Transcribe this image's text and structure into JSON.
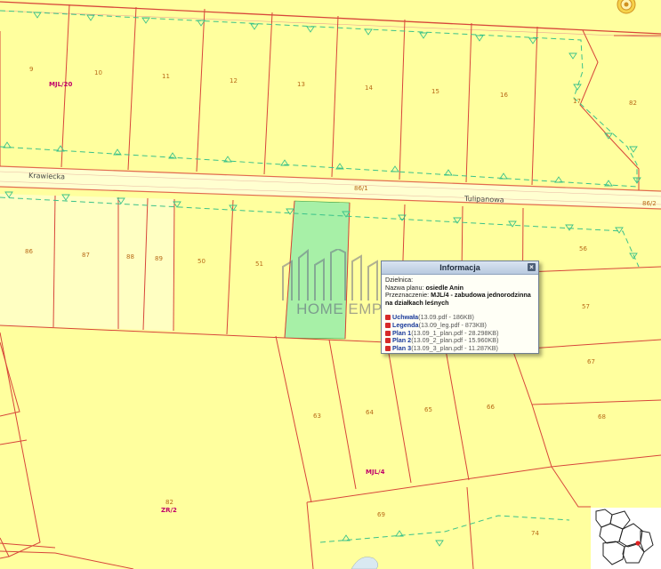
{
  "map": {
    "parcels": [
      "9",
      "10",
      "11",
      "12",
      "13",
      "14",
      "15",
      "16",
      "17",
      "82",
      "86",
      "87",
      "88",
      "89",
      "50",
      "51",
      "56",
      "57",
      "67",
      "68",
      "63",
      "64",
      "65",
      "66",
      "69",
      "74",
      "82"
    ],
    "zones": [
      "MJL/20",
      "MJL/4",
      "ZR/2"
    ],
    "streets": [
      "Krawiecka",
      "Tulipanowa"
    ],
    "road_ids": [
      "86/1",
      "86/2"
    ],
    "colors": {
      "base": "#ffff9e",
      "highlight": "#a7f0a7",
      "boundary": "#d7463a",
      "forest_line": "#3bc28a"
    }
  },
  "popup": {
    "title": "Informacja",
    "close_icon": "close-icon",
    "district_label": "Dzielnica:",
    "plan_label": "Nazwa planu: ",
    "plan_value": "osiedle Anin",
    "purpose_label": "Przeznaczenie: ",
    "purpose_value": "MJL/4 - zabudowa jednorodzinna na działkach leśnych",
    "documents": [
      {
        "name": "Uchwała",
        "meta": "(13.09.pdf - 186KB)"
      },
      {
        "name": "Legenda",
        "meta": "(13.09_leg.pdf - 873KB)"
      },
      {
        "name": "Plan 1",
        "meta": "(13.09_1_plan.pdf - 28.298KB)"
      },
      {
        "name": "Plan 2",
        "meta": "(13.09_2_plan.pdf - 15.960KB)"
      },
      {
        "name": "Plan 3",
        "meta": "(13.09_3_plan.pdf - 11.287KB)"
      }
    ]
  },
  "watermark": {
    "text": "HOME EMPEROR"
  }
}
